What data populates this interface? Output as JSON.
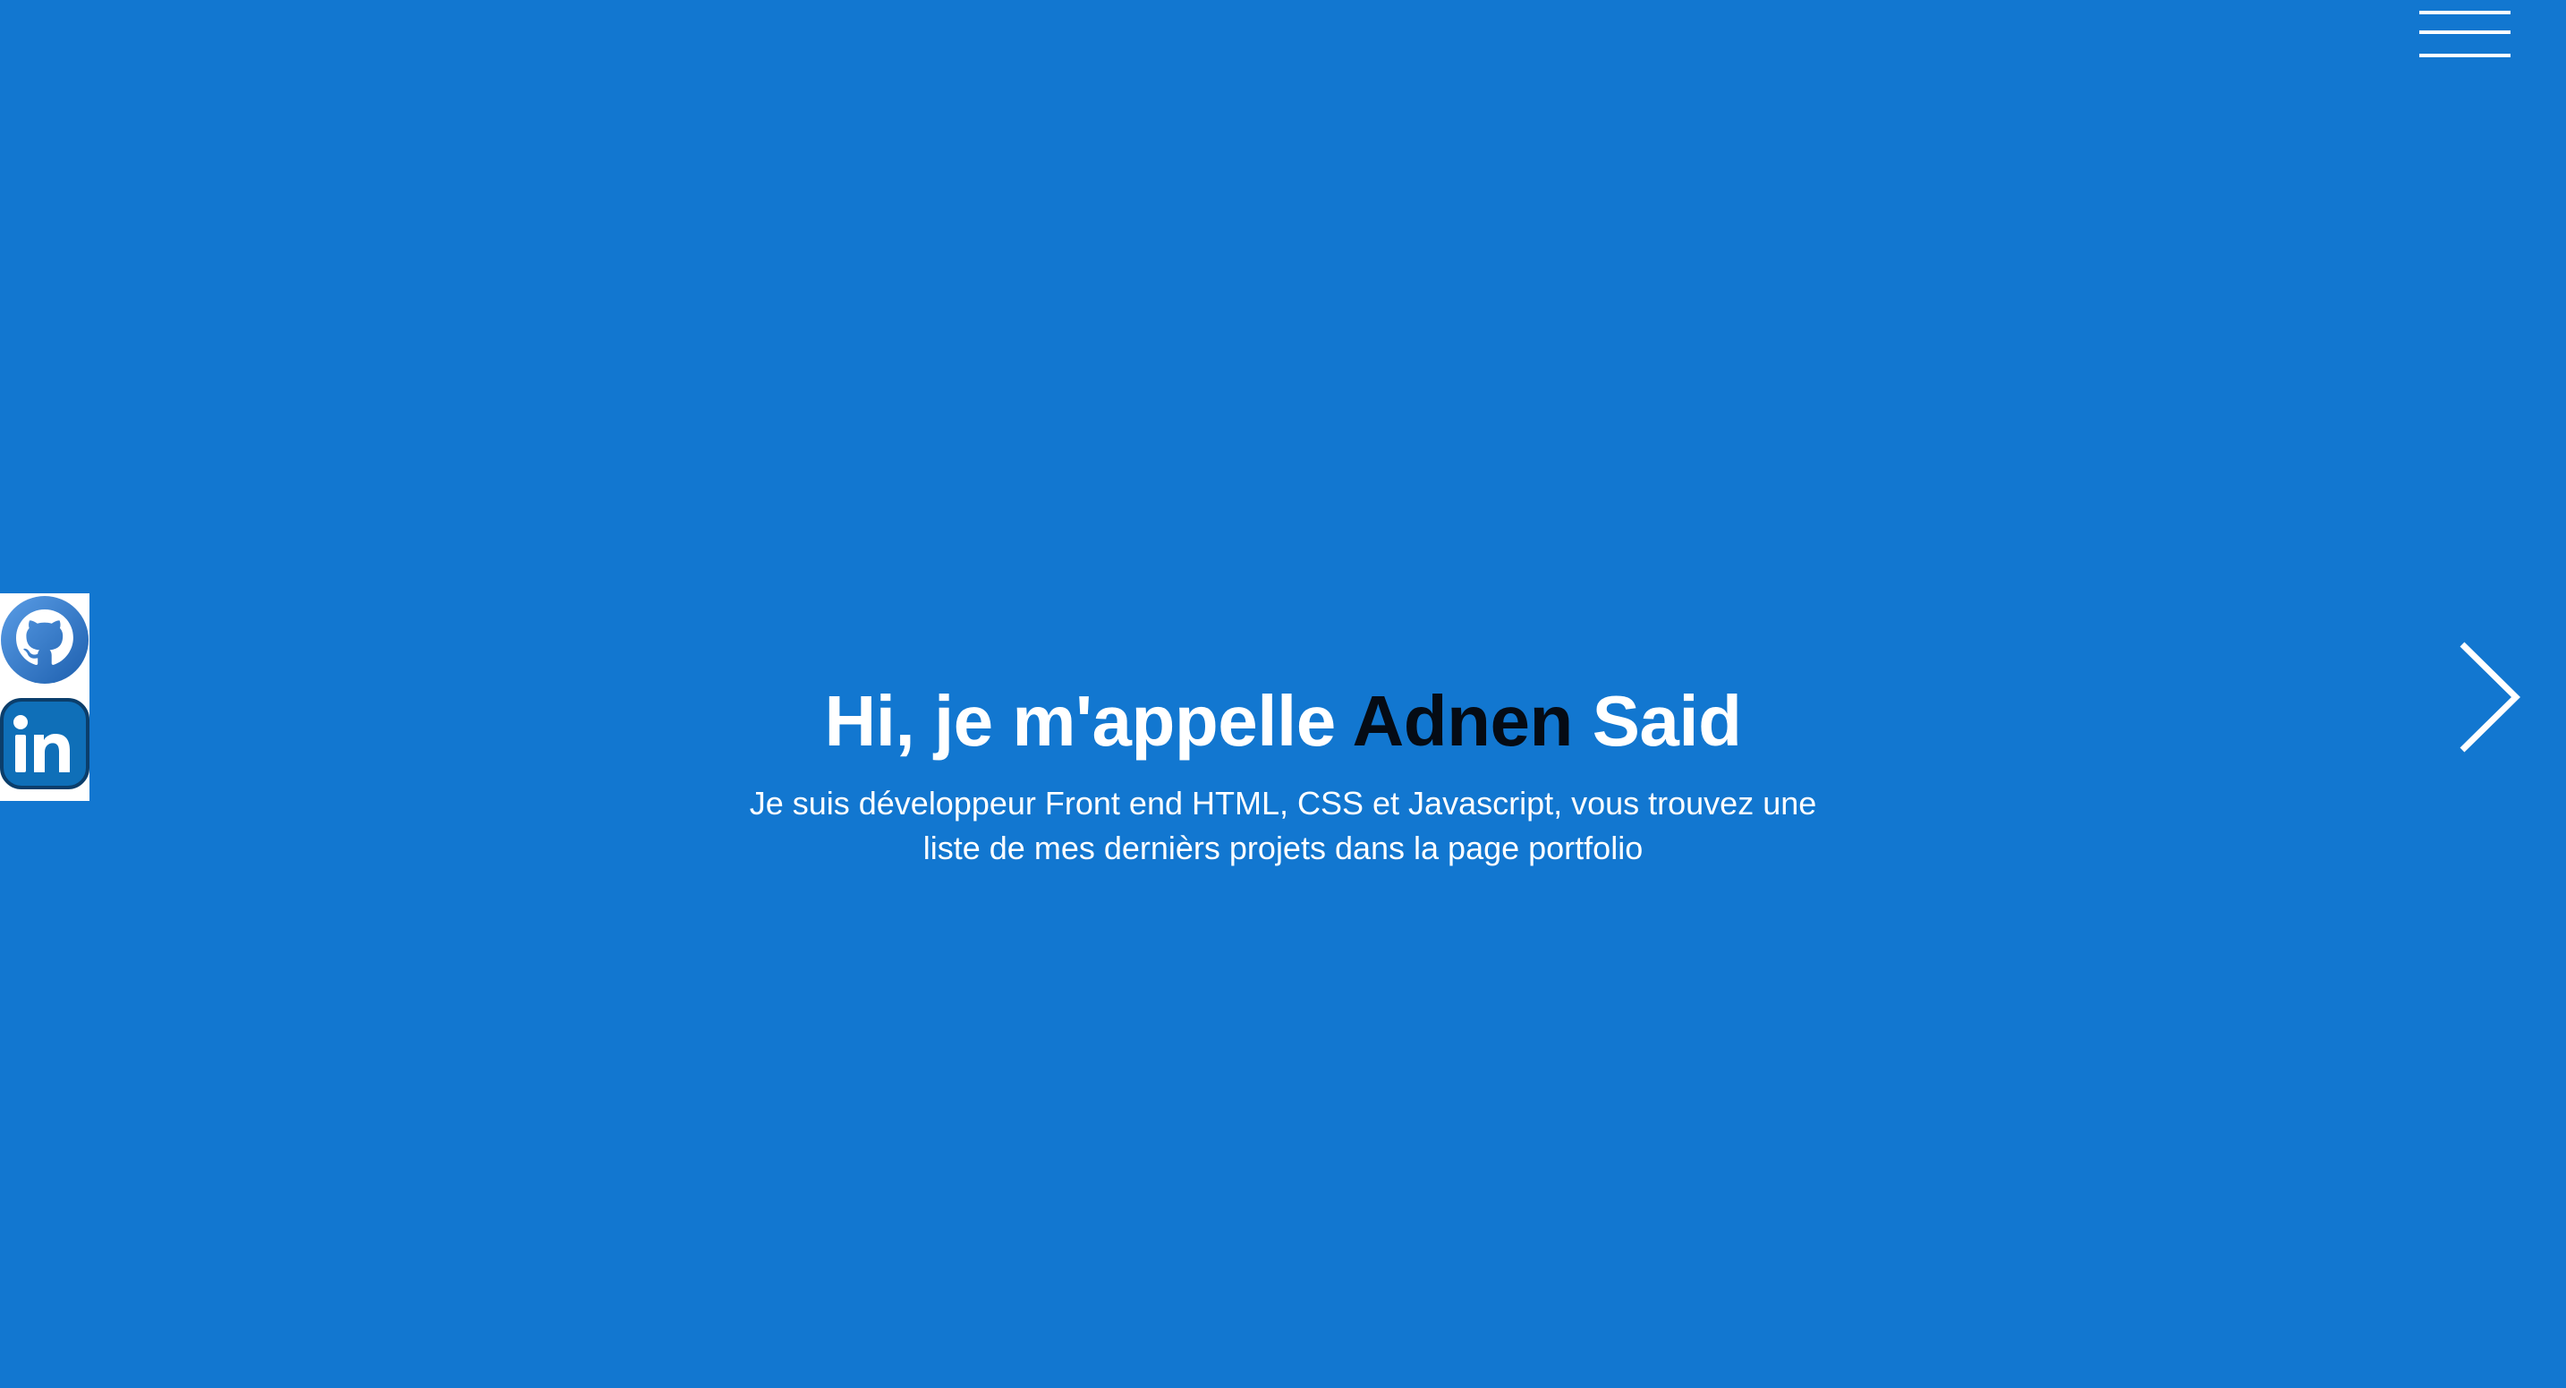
{
  "header": {
    "menu_icon": "hamburger-menu-icon"
  },
  "social": {
    "items": [
      {
        "name": "GitHub",
        "icon": "github-icon"
      },
      {
        "name": "LinkedIn",
        "icon": "linkedin-icon"
      }
    ]
  },
  "hero": {
    "title_prefix": "Hi, je m'appelle ",
    "title_first_name": "Adnen",
    "title_last_name": " Said",
    "subtitle": "Je suis développeur Front end HTML, CSS et Javascript, vous trouvez une liste de mes dernièrs projets dans la page portfolio"
  },
  "navigation": {
    "next_icon": "chevron-right-icon"
  },
  "colors": {
    "background": "#1277d0",
    "text": "#ffffff",
    "accent_name": "#050b14",
    "github_blue": "#3f86d8",
    "linkedin_blue": "#0f6fb8"
  }
}
